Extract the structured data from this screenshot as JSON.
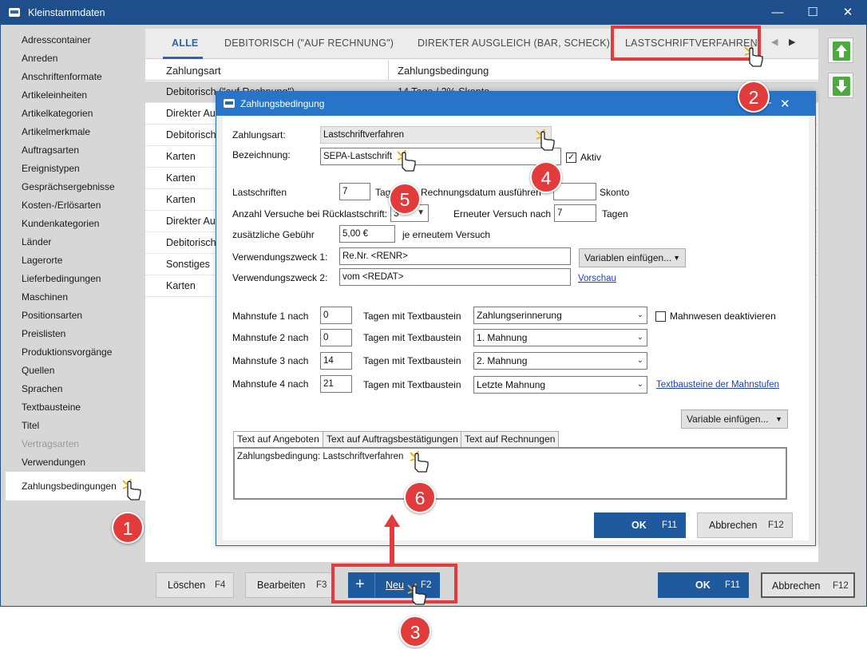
{
  "window": {
    "title": "Kleinstammdaten"
  },
  "sidebar": {
    "items": [
      {
        "label": "Adresscontainer"
      },
      {
        "label": "Anreden"
      },
      {
        "label": "Anschriftenformate"
      },
      {
        "label": "Artikeleinheiten"
      },
      {
        "label": "Artikelkategorien"
      },
      {
        "label": "Artikelmerkmale"
      },
      {
        "label": "Auftragsarten"
      },
      {
        "label": "Ereignistypen"
      },
      {
        "label": "Gesprächsergebnisse"
      },
      {
        "label": "Kosten-/Erlösarten"
      },
      {
        "label": "Kundenkategorien"
      },
      {
        "label": "Länder"
      },
      {
        "label": "Lagerorte"
      },
      {
        "label": "Lieferbedingungen"
      },
      {
        "label": "Maschinen"
      },
      {
        "label": "Positionsarten"
      },
      {
        "label": "Preislisten"
      },
      {
        "label": "Produktionsvorgänge"
      },
      {
        "label": "Quellen"
      },
      {
        "label": "Sprachen"
      },
      {
        "label": "Textbausteine"
      },
      {
        "label": "Titel"
      },
      {
        "label": "Vertragsarten"
      },
      {
        "label": "Verwendungen"
      },
      {
        "label": "Zahlungsbedingungen"
      }
    ]
  },
  "tabs": [
    "ALLE",
    "DEBITORISCH (\"AUF RECHNUNG\")",
    "DIREKTER AUSGLEICH (BAR, SCHECK)",
    "LASTSCHRIFTVERFAHREN"
  ],
  "grid": {
    "headers": [
      "Zahlungsart",
      "Zahlungsbedingung"
    ],
    "rows": [
      {
        "art": "Debitorisch (\"auf Rechnung\")",
        "bed": "14 Tage / 2% Skonto"
      },
      {
        "art": "Direkter Au",
        "bed": ""
      },
      {
        "art": "Debitorisch",
        "bed": ""
      },
      {
        "art": "Karten",
        "bed": ""
      },
      {
        "art": "Karten",
        "bed": ""
      },
      {
        "art": "Karten",
        "bed": ""
      },
      {
        "art": "Direkter Au",
        "bed": ""
      },
      {
        "art": "Debitorisch",
        "bed": ""
      },
      {
        "art": "Sonstiges",
        "bed": ""
      },
      {
        "art": "Karten",
        "bed": ""
      }
    ]
  },
  "bottom": {
    "delete": "Löschen",
    "delete_key": "F4",
    "edit": "Bearbeiten",
    "edit_key": "F3",
    "new": "Neu",
    "new_key": "F2",
    "ok": "OK",
    "ok_key": "F11",
    "cancel": "Abbrechen",
    "cancel_key": "F12"
  },
  "dialog": {
    "title": "Zahlungsbedingung",
    "zahlungsart_label": "Zahlungsart:",
    "zahlungsart_value": "Lastschriftverfahren",
    "bezeichnung_label": "Bezeichnung:",
    "bezeichnung_value": "SEPA-Lastschrift",
    "aktiv_label": "Aktiv",
    "lastschriften_label": "Lastschriften",
    "lastschriften_value": "7",
    "tage_label": "Tag",
    "rechnungsdatum_label": "Rechnungsdatum ausführen",
    "skonto_label": "Skonto",
    "versuche_label": "Anzahl Versuche bei Rücklastschrift:",
    "versuche_value": "3",
    "erneut_label": "Erneuter Versuch nach",
    "erneut_value": "7",
    "erneut_unit": "Tagen",
    "gebuehr_label": "zusätzliche Gebühr",
    "gebuehr_value": "5,00 €",
    "gebuehr_suffix": "je erneutem Versuch",
    "vz1_label": "Verwendungszweck 1:",
    "vz1_value": "Re.Nr. <RENR>",
    "vz2_label": "Verwendungszweck 2:",
    "vz2_value": "vom <REDAT>",
    "variablen_btn": "Variablen einfügen...",
    "vorschau_link": "Vorschau",
    "mahnstufen": [
      {
        "label": "Mahnstufe 1 nach",
        "days": "0",
        "text_label": "Tagen mit Textbaustein",
        "baustein": "Zahlungserinnerung"
      },
      {
        "label": "Mahnstufe 2 nach",
        "days": "0",
        "text_label": "Tagen mit Textbaustein",
        "baustein": "1. Mahnung"
      },
      {
        "label": "Mahnstufe 3 nach",
        "days": "14",
        "text_label": "Tagen mit Textbaustein",
        "baustein": "2. Mahnung"
      },
      {
        "label": "Mahnstufe 4 nach",
        "days": "21",
        "text_label": "Tagen mit Textbaustein",
        "baustein": "Letzte Mahnung"
      }
    ],
    "mahnwesen_label": "Mahnwesen deaktivieren",
    "textbausteine_link": "Textbausteine der Mahnstufen",
    "variable_btn": "Variable einfügen...",
    "subtabs": [
      "Text auf Angeboten",
      "Text auf Auftragsbestätigungen",
      "Text auf Rechnungen"
    ],
    "text_value": "Zahlungsbedingung: Lastschriftverfahren",
    "ok": "OK",
    "ok_key": "F11",
    "cancel": "Abbrechen",
    "cancel_key": "F12"
  },
  "annotations": [
    "1",
    "2",
    "3",
    "4",
    "5",
    "6"
  ],
  "colors": {
    "accent": "#2466b8",
    "titlebar": "#1f4e8c",
    "annotation": "#e23b3b",
    "arrow_green": "#4caa3f"
  }
}
